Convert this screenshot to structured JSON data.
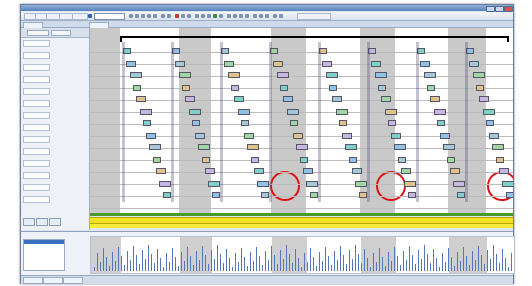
{
  "window": {
    "title": "",
    "colors": {
      "frame": "#6b7f99",
      "title_bar": "#5a83bd",
      "shade": "#c9c9c9",
      "highlight_circle": "#dd1111",
      "bar_green": "#4a9a2a",
      "bar_yellow": "#f2e226"
    }
  },
  "toolbar": {
    "items": [
      "",
      "",
      "",
      "",
      ""
    ],
    "select_label": ""
  },
  "tabs": [
    "",
    ""
  ],
  "left_panel": {
    "headers": [
      "",
      ""
    ],
    "tracks": [
      "",
      "",
      "",
      "",
      "",
      "",
      "",
      "",
      "",
      "",
      "",
      "",
      "",
      ""
    ],
    "buttons": [
      "",
      "",
      ""
    ]
  },
  "bottom_panel": {
    "title": "",
    "list_items": [
      "",
      "",
      "",
      ""
    ]
  },
  "status_tabs": [
    "",
    "",
    ""
  ],
  "icons": [
    "window-minimize-icon",
    "window-maximize-icon",
    "window-close-icon",
    "toolbar-icon"
  ]
}
